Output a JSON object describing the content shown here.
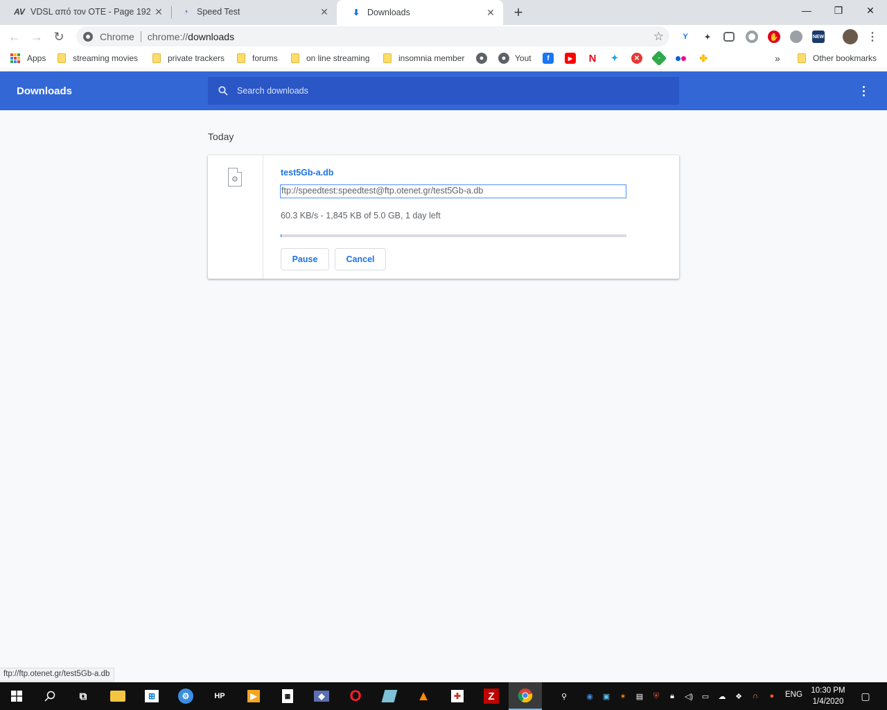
{
  "tabs": [
    {
      "title": "VDSL από τον ΟΤΕ - Page 192",
      "icon": "av-logo-icon",
      "icon_text": "AV",
      "close": "✕"
    },
    {
      "title": "Speed Test",
      "icon": "speedtest-icon",
      "icon_text": "◔",
      "close": "✕"
    },
    {
      "title": "Downloads",
      "icon": "download-icon",
      "icon_text": "⬇",
      "close": "✕"
    }
  ],
  "window_controls": {
    "minimize": "—",
    "maximize": "❐",
    "close": "✕",
    "new_tab": "+"
  },
  "toolbar": {
    "back": "←",
    "forward": "→",
    "reload": "↻",
    "scheme_label": "Chrome",
    "url_prefix": "chrome://",
    "url_path": "downloads",
    "star": "☆",
    "menu": "⋮"
  },
  "bookmarks": {
    "apps": "Apps",
    "folders": [
      "streaming movies",
      "private trackers",
      "forums",
      "on line streaming",
      "insomnia member"
    ],
    "youtube_short": "Yout",
    "overflow": "»",
    "other": "Other bookmarks"
  },
  "downloads_page": {
    "title": "Downloads",
    "search_placeholder": "Search downloads",
    "section": "Today",
    "item": {
      "filename": "test5Gb-a.db",
      "url": "ftp://speedtest:speedtest@ftp.otenet.gr/test5Gb-a.db",
      "status": "60.3 KB/s - 1,845 KB of 5.0 GB, 1 day left",
      "progress_fraction": 0.0004,
      "pause": "Pause",
      "cancel": "Cancel"
    }
  },
  "status_bar": "ftp://ftp.otenet.gr/test5Gb-a.db",
  "taskbar": {
    "language": "ENG",
    "time": "10:30 PM",
    "date": "1/4/2020"
  },
  "colors": {
    "accent": "#3367d6",
    "link": "#1a73e8"
  }
}
